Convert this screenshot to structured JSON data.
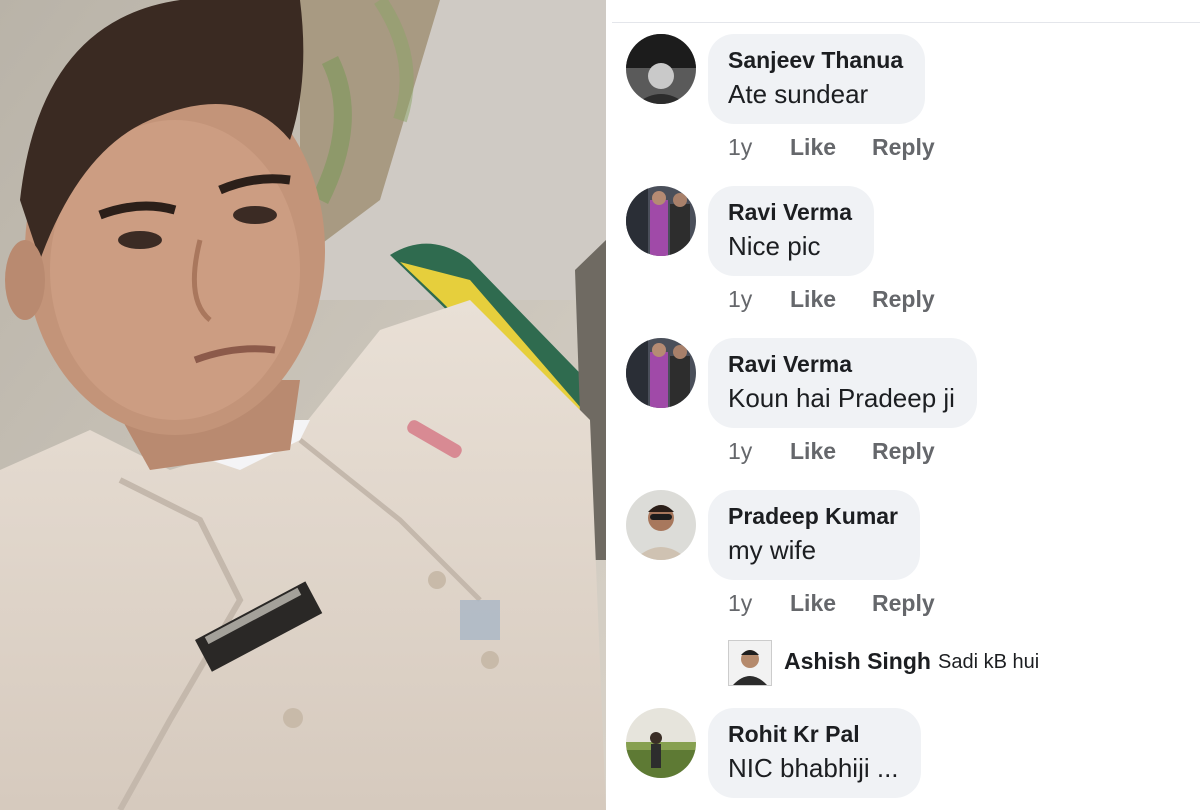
{
  "comments": [
    {
      "author": "Sanjeev Thanua",
      "text": "Ate sundear",
      "time": "1y",
      "like": "Like",
      "reply": "Reply",
      "avatar_icon": "profile-photo"
    },
    {
      "author": "Ravi Verma",
      "text": "Nice pic",
      "time": "1y",
      "like": "Like",
      "reply": "Reply",
      "avatar_icon": "profile-photo"
    },
    {
      "author": "Ravi Verma",
      "text": "Koun hai Pradeep ji",
      "time": "1y",
      "like": "Like",
      "reply": "Reply",
      "avatar_icon": "profile-photo"
    },
    {
      "author": "Pradeep Kumar",
      "text": "my wife",
      "time": "1y",
      "like": "Like",
      "reply": "Reply",
      "avatar_icon": "profile-photo"
    },
    {
      "author": "Rohit Kr Pal",
      "text": "NIC bhabhiji ...",
      "avatar_icon": "profile-photo"
    }
  ],
  "reply_preview": {
    "author": "Ashish Singh",
    "text": "Sadi kB hui"
  },
  "colors": {
    "bubble": "#f0f2f5",
    "name": "#1c1e21",
    "meta": "#65676b"
  }
}
